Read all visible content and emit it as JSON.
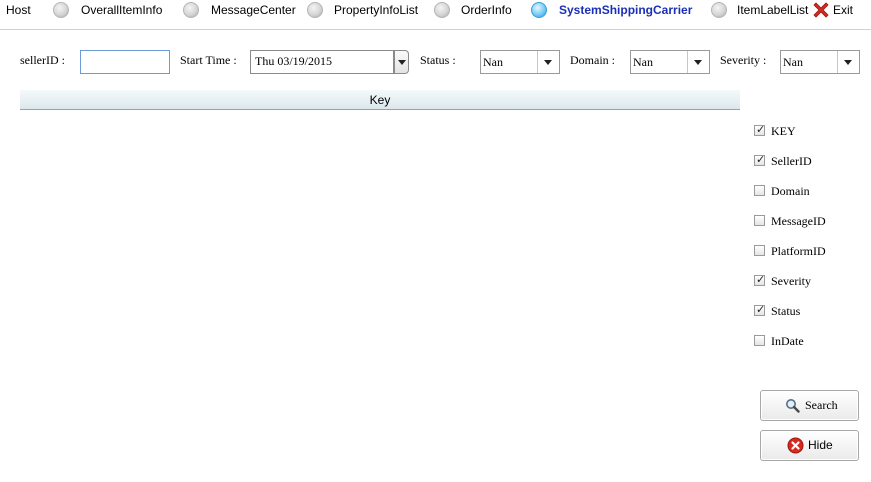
{
  "nav": {
    "host": "Host",
    "items": [
      {
        "label": "OverallItemInfo",
        "active": false
      },
      {
        "label": "MessageCenter",
        "active": false
      },
      {
        "label": "PropertyInfoList",
        "active": false
      },
      {
        "label": "OrderInfo",
        "active": false
      },
      {
        "label": "SystemShippingCarrier",
        "active": true
      },
      {
        "label": "ItemLabelList",
        "active": false
      }
    ],
    "exit": "Exit"
  },
  "filters": {
    "seller_label": "sellerID :",
    "seller_value": "",
    "start_time_label": "Start Time :",
    "start_time_value": "Thu 03/19/2015",
    "status_label": "Status :",
    "status_value": "Nan",
    "domain_label": "Domain :",
    "domain_value": "Nan",
    "severity_label": "Severity :",
    "severity_value": "Nan"
  },
  "grid": {
    "columns": [
      "Key"
    ]
  },
  "column_options": [
    {
      "label": "KEY",
      "checked": true
    },
    {
      "label": "SellerID",
      "checked": true
    },
    {
      "label": "Domain",
      "checked": false
    },
    {
      "label": "MessageID",
      "checked": false
    },
    {
      "label": "PlatformID",
      "checked": false
    },
    {
      "label": "Severity",
      "checked": true
    },
    {
      "label": "Status",
      "checked": true
    },
    {
      "label": "InDate",
      "checked": false
    }
  ],
  "buttons": {
    "search": "Search",
    "hide": "Hide"
  },
  "icons": {
    "exit": "red-x-icon",
    "search": "magnifier-icon",
    "hide": "red-circle-x-icon"
  },
  "colors": {
    "active_tab": "#1a2fb8",
    "exit_red": "#d62a1f"
  }
}
